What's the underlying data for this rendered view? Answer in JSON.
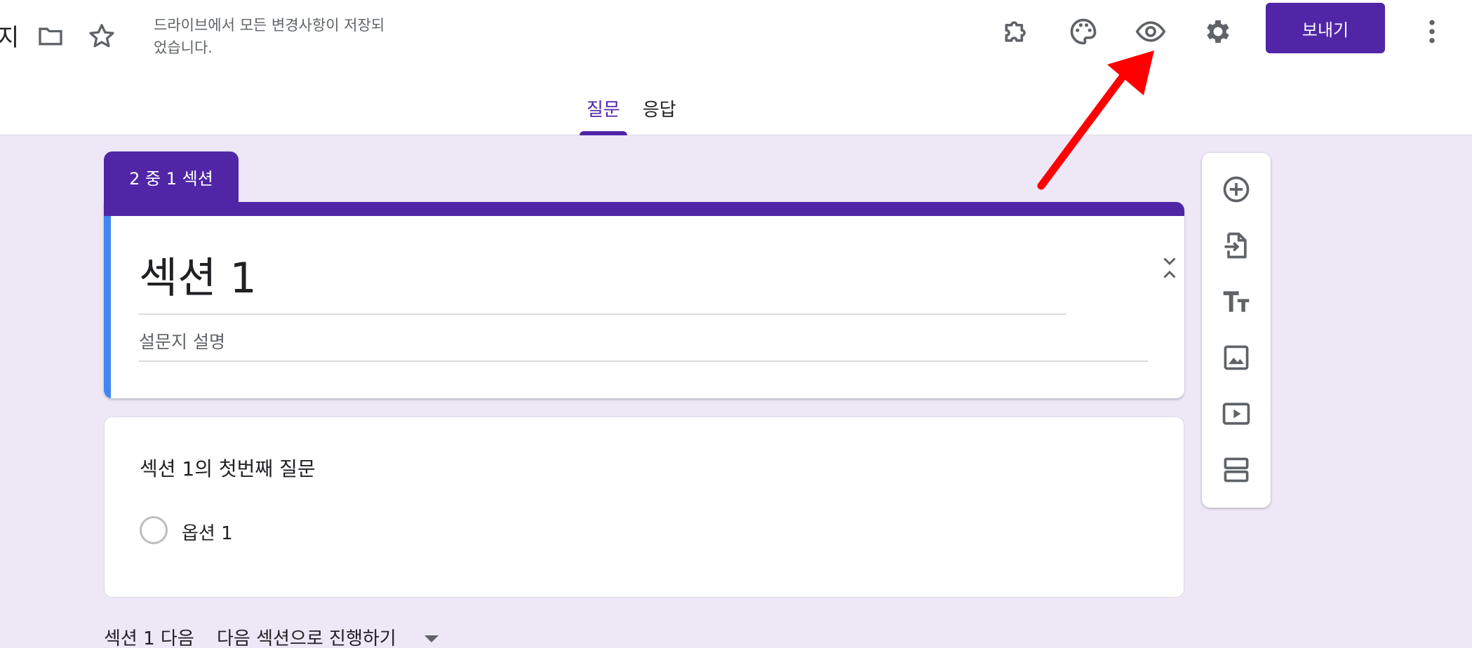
{
  "header": {
    "title_fragment": "지",
    "save_status": "드라이브에서 모든 변경사항이 저장되었습니다.",
    "send_label": "보내기",
    "icons": [
      "folder-icon",
      "star-icon",
      "puzzle-icon",
      "palette-icon",
      "eye-icon",
      "gear-icon",
      "more-vert-icon"
    ]
  },
  "tabs": [
    {
      "label": "질문",
      "active": true
    },
    {
      "label": "응답",
      "active": false
    }
  ],
  "section": {
    "tab_label": "2 중 1 섹션",
    "title": "섹션 1",
    "description": "설문지 설명"
  },
  "question": {
    "title": "섹션 1의 첫번째 질문",
    "options": [
      "옵션 1"
    ]
  },
  "after_section": {
    "label": "섹션 1 다음",
    "selected": "다음 섹션으로 진행하기"
  },
  "toolbar": {
    "icons": [
      "add-circle-icon",
      "import-icon",
      "title-icon",
      "image-icon",
      "video-icon",
      "section-icon"
    ]
  },
  "colors": {
    "brand": "#5026a7",
    "accent": "#4285f4",
    "background": "#ede7f6",
    "annotation": "#ff0000"
  }
}
